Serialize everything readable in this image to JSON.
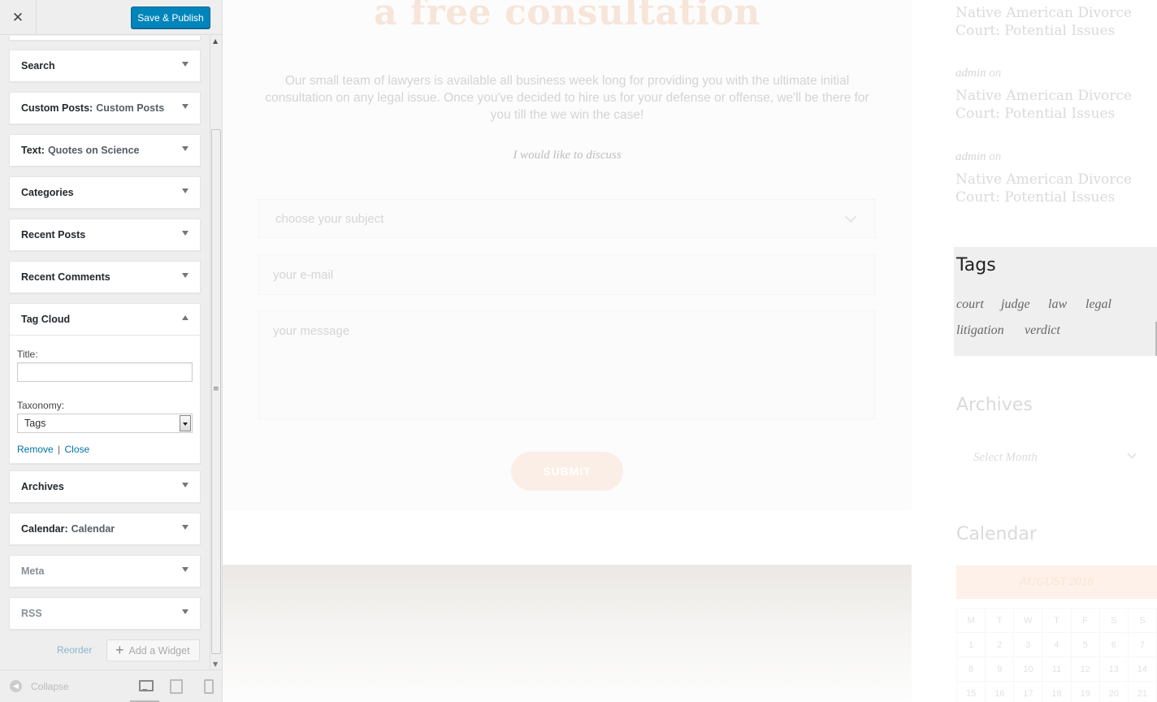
{
  "customizer": {
    "close_icon": "✕",
    "save_label": "Save & Publish",
    "widgets": [
      {
        "name": "Search",
        "sub": ""
      },
      {
        "name": "Custom Posts:",
        "sub": "Custom Posts"
      },
      {
        "name": "Text:",
        "sub": "Quotes on Science"
      },
      {
        "name": "Categories",
        "sub": ""
      },
      {
        "name": "Recent Posts",
        "sub": ""
      },
      {
        "name": "Recent Comments",
        "sub": ""
      },
      {
        "name": "Tag Cloud",
        "sub": ""
      },
      {
        "name": "Archives",
        "sub": ""
      },
      {
        "name": "Calendar:",
        "sub": "Calendar"
      },
      {
        "name": "Meta",
        "sub": ""
      },
      {
        "name": "RSS",
        "sub": ""
      }
    ],
    "tag_cloud": {
      "title_label": "Title:",
      "title_value": "",
      "taxonomy_label": "Taxonomy:",
      "taxonomy_value": "Tags",
      "remove_label": "Remove",
      "separator": "|",
      "close_label": "Close"
    },
    "reorder_label": "Reorder",
    "add_widget_label": "Add a Widget",
    "collapse_label": "Collapse"
  },
  "preview": {
    "hero_title": "a free consultation",
    "intro": "Our small team of lawyers is available all business week long for providing you with the ultimate initial consultation on any legal issue. Once you've decided to hire us for your defense or offense, we'll be there for you till the we win the case!",
    "discuss_label": "I would like to discuss",
    "subject_placeholder": "choose your subject",
    "email_placeholder": "your e-mail",
    "message_placeholder": "your message",
    "submit_label": "SUBMIT",
    "recent_comments": [
      {
        "author": "",
        "on": "",
        "link": "Native American Divorce Court: Potential Issues"
      },
      {
        "author": "admin",
        "on": "on",
        "link": "Native American Divorce Court: Potential Issues"
      },
      {
        "author": "admin",
        "on": "on",
        "link": "Native American Divorce Court: Potential Issues"
      }
    ],
    "tags_title": "Tags",
    "tags": [
      "court",
      "judge",
      "law",
      "legal",
      "litigation",
      "verdict"
    ],
    "archives_title": "Archives",
    "archives_placeholder": "Select Month",
    "calendar_title": "Calendar",
    "calendar_month": "AUGUST 2016",
    "calendar_days": [
      "M",
      "T",
      "W",
      "T",
      "F",
      "S",
      "S"
    ],
    "calendar_rows": [
      [
        "1",
        "2",
        "3",
        "4",
        "5",
        "6",
        "7"
      ],
      [
        "8",
        "9",
        "10",
        "11",
        "12",
        "13",
        "14"
      ],
      [
        "15",
        "16",
        "17",
        "18",
        "19",
        "20",
        "21"
      ]
    ]
  }
}
